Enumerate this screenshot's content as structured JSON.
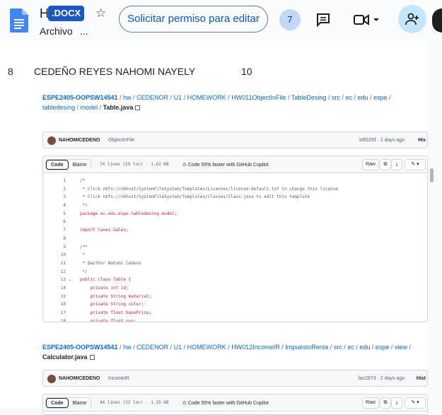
{
  "header": {
    "title_initial": "H",
    "badge": ".DOCX",
    "menu_archivo": "Archivo",
    "menu_more": "...",
    "permission_button": "Solicitar permiso para editar",
    "viewer_count": "7"
  },
  "document": {
    "line_number": "8",
    "student_name": "CEDEÑO REYES NAHOMI NAYELY",
    "score": "10"
  },
  "snippet1": {
    "breadcrumb": [
      "ESPE2405-OOPSW14541",
      "hw",
      "CEDENOR",
      "U1",
      "HOMEWORK",
      "HW011ObjectInFile",
      "TableDesing",
      "src",
      "ec",
      "edu",
      "espe",
      "tabledesing",
      "model"
    ],
    "file": "Table.java",
    "commit_user": "NAHOMICEDENO",
    "commit_msg": "ObjectInFile",
    "commit_hash": "b8f105f · 2 days ago",
    "history": "His",
    "tab_code": "Code",
    "tab_blame": "Blame",
    "meta": "74 lines (59 loc) · 1.62 KB",
    "copilot": "Code 55% faster with GitHub Copilot",
    "raw": "Raw",
    "code_lines": [
      {
        "n": "1",
        "t": "/*",
        "k": "cm"
      },
      {
        "n": "2",
        "t": " * Click nbfs://nbhost/SystemFileSystem/Templates/Licenses/license-default.txt to change this license",
        "k": "cm"
      },
      {
        "n": "3",
        "t": " * Click nbfs://nbhost/SystemFileSystem/Templates/Classes/Class.java to edit this template",
        "k": "cm"
      },
      {
        "n": "4",
        "t": " */",
        "k": "cm"
      },
      {
        "n": "5",
        "t": "package ec.edu.espe.tabledesing.model;",
        "k": "kw"
      },
      {
        "n": "6",
        "t": "",
        "k": "pl"
      },
      {
        "n": "7",
        "t": "import taxes.Sales;",
        "k": "kw"
      },
      {
        "n": "8",
        "t": "",
        "k": "pl"
      },
      {
        "n": "9",
        "t": "/**",
        "k": "cm"
      },
      {
        "n": "10",
        "t": " *",
        "k": "cm"
      },
      {
        "n": "11",
        "t": " * @author Nahomi Cedeno",
        "k": "cm"
      },
      {
        "n": "12",
        "t": " */",
        "k": "cm"
      },
      {
        "n": "13",
        "t": "public class Table {",
        "k": "kw"
      },
      {
        "n": "14",
        "t": "    private int id;",
        "k": "kw"
      },
      {
        "n": "15",
        "t": "    private String material;",
        "k": "kw"
      },
      {
        "n": "16",
        "t": "    private String color;",
        "k": "kw"
      },
      {
        "n": "17",
        "t": "    private float basePrice;",
        "k": "kw"
      },
      {
        "n": "18",
        "t": "    private float pvp;",
        "k": "kw"
      }
    ]
  },
  "snippet2": {
    "breadcrumb": [
      "ESPE2405-OOPSW14541",
      "hw",
      "CEDENOR",
      "U1",
      "HOMEWORK",
      "HW012IncomeIR",
      "ImpuestoRenta",
      "src",
      "ec",
      "edu",
      "espe",
      "view"
    ],
    "file": "Calculator.java",
    "commit_user": "NAHOMICEDENO",
    "commit_msg": "IncomeIR",
    "commit_hash": "fac2873 · 2 days ago",
    "history": "Hist",
    "tab_code": "Code",
    "tab_blame": "Blame",
    "meta": "44 lines (32 loc) · 1.35 KB",
    "copilot": "Code 55% faster with GitHub Copilot",
    "raw": "Raw"
  },
  "colors": {
    "link": "#0969da",
    "accent": "#0b57d0",
    "badge": "#1a56c4"
  }
}
